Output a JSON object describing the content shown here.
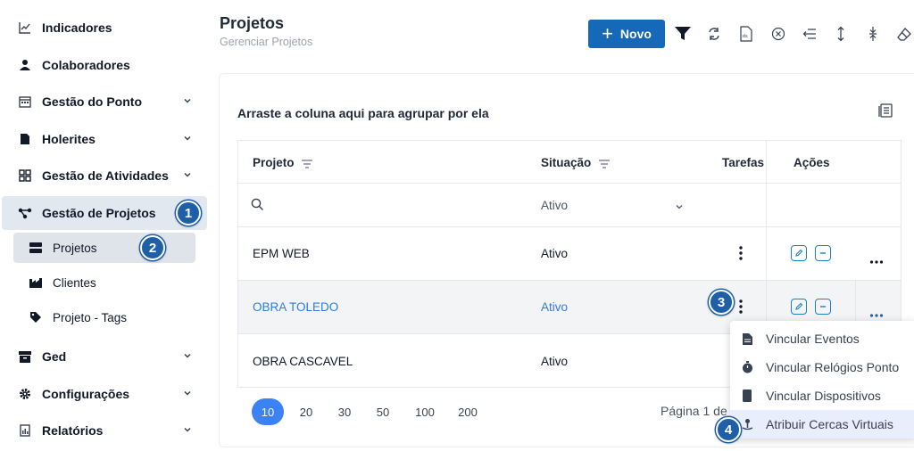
{
  "sidebar": {
    "items": [
      {
        "label": "Indicadores",
        "icon": "chart-line-icon"
      },
      {
        "label": "Colaboradores",
        "icon": "user-icon"
      },
      {
        "label": "Gestão do Ponto",
        "icon": "calendar-icon"
      },
      {
        "label": "Holerites",
        "icon": "document-icon"
      },
      {
        "label": "Gestão de Atividades",
        "icon": "grid-icon"
      },
      {
        "label": "Gestão de Projetos",
        "icon": "network-icon"
      }
    ],
    "subitems": [
      {
        "label": "Projetos",
        "icon": "server-icon"
      },
      {
        "label": "Clientes",
        "icon": "industry-icon"
      },
      {
        "label": "Projeto - Tags",
        "icon": "tag-icon"
      }
    ],
    "bottom_items": [
      {
        "label": "Ged",
        "icon": "archive-icon"
      },
      {
        "label": "Configurações",
        "icon": "gear-icon"
      },
      {
        "label": "Relatórios",
        "icon": "report-icon"
      }
    ]
  },
  "header": {
    "title": "Projetos",
    "subtitle": "Gerenciar Projetos",
    "new_button": "Novo"
  },
  "grid": {
    "group_hint": "Arraste a coluna aqui para agrupar por ela",
    "columns": [
      "Projeto",
      "Situação",
      "Tarefas",
      "Ações"
    ],
    "filter": {
      "status_value": "Ativo"
    },
    "rows": [
      {
        "projeto": "EPM WEB",
        "situacao": "Ativo"
      },
      {
        "projeto": "OBRA TOLEDO",
        "situacao": "Ativo"
      },
      {
        "projeto": "OBRA CASCAVEL",
        "situacao": "Ativo"
      }
    ]
  },
  "pagination": {
    "sizes": [
      "10",
      "20",
      "30",
      "50",
      "100",
      "200"
    ],
    "selected": "10",
    "info": "Página 1 de"
  },
  "menu": {
    "items": [
      {
        "label": "Vincular Eventos",
        "icon": "file-icon"
      },
      {
        "label": "Vincular Relógios Ponto",
        "icon": "stopwatch-icon"
      },
      {
        "label": "Vincular Dispositivos",
        "icon": "device-icon"
      },
      {
        "label": "Atribuir Cercas Virtuais",
        "icon": "map-pin-icon"
      }
    ]
  },
  "badges": [
    "1",
    "2",
    "3",
    "4"
  ],
  "colors": {
    "primary": "#1668b8",
    "link": "#2f7be6",
    "badge": "#1f5fa8",
    "active_page": "#3b82f6"
  }
}
